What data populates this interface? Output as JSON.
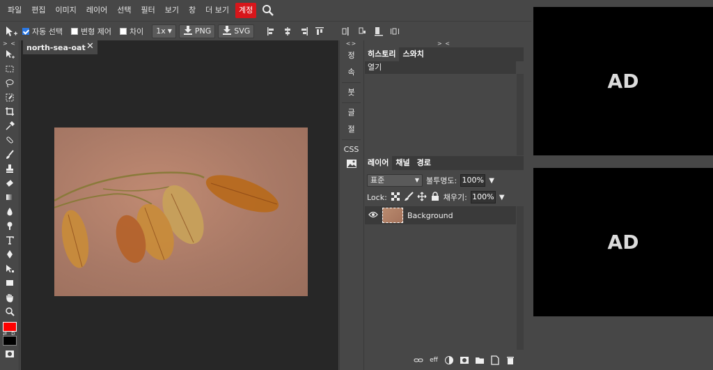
{
  "menubar": {
    "items": [
      "파일",
      "편집",
      "이미지",
      "레이어",
      "선택",
      "필터",
      "보기",
      "창",
      "더 보기"
    ],
    "account": "계정",
    "search_icon": "search-icon"
  },
  "options": {
    "auto_select": "자동 선택",
    "transform": "변형 제어",
    "distance": "차이",
    "zoom": "1x",
    "png": "PNG",
    "svg": "SVG"
  },
  "toolbar": {
    "collapse": "> <",
    "swatch_labels": "⇄ D",
    "fg_color": "#ff0000",
    "bg_color": "#000000"
  },
  "document": {
    "tab_title": "north-sea-oat",
    "close": "✕"
  },
  "mini_panel": {
    "collapse": "<>",
    "items": [
      "정",
      "속",
      "붓",
      "글",
      "절",
      "CSS"
    ]
  },
  "history": {
    "collapse": "> <",
    "tabs": [
      "히스토리",
      "스와치"
    ],
    "items": [
      "열기"
    ]
  },
  "layers": {
    "tabs": [
      "레이어",
      "채널",
      "경로"
    ],
    "blend_mode": "표준",
    "opacity_label": "불투명도:",
    "opacity": "100%",
    "lock_label": "Lock:",
    "fill_label": "채우기:",
    "fill": "100%",
    "rows": [
      {
        "name": "Background"
      }
    ],
    "footer_eff": "eff"
  },
  "ads": {
    "label": "AD"
  }
}
